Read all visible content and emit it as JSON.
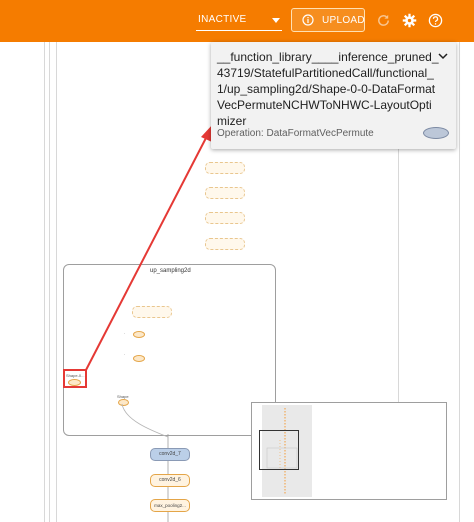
{
  "toolbar": {
    "run_status": "INACTIVE",
    "upload_label": "UPLOAD",
    "icons": [
      "info-icon",
      "refresh-icon",
      "gear-icon",
      "help-icon"
    ],
    "colors": {
      "bar": "#f57c00",
      "text": "#ffffff"
    }
  },
  "info_card": {
    "title": "__function_library____inference_pruned_43719/StatefulPartitionedCall/functional_1/up_sampling2d/Shape-0-0-DataFormatVecPermuteNCHWToNHWC-LayoutOptimizer",
    "operation": "Operation: DataFormatVecPermute",
    "colors": {
      "background": "#f2f2f2",
      "node": "#bcc7d8"
    }
  },
  "graph": {
    "scope_label": "up_sampling2d",
    "inner_labels": {
      "shape_small": "Shape-0...",
      "shape": "Shape"
    },
    "nodes": [
      "conv2d_7",
      "conv2d_6",
      "max_pooling2..."
    ],
    "annotation_color": "#e53935"
  }
}
